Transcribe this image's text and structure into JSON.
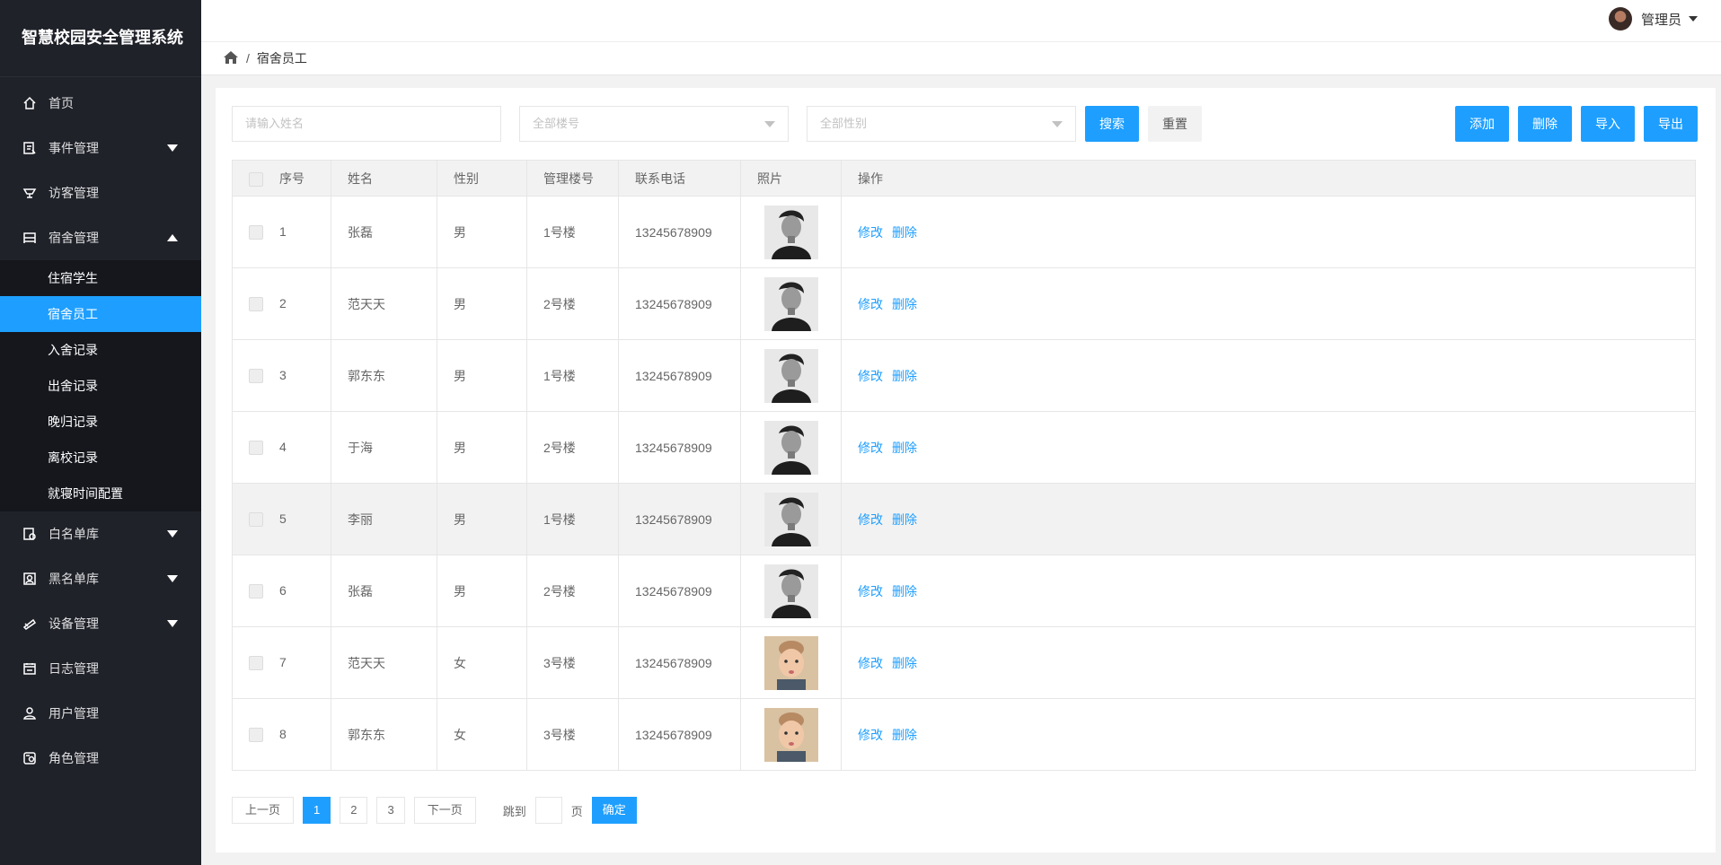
{
  "app": {
    "title": "智慧校园安全管理系统"
  },
  "sidebar": {
    "items": [
      {
        "label": "首页",
        "icon": "home-icon"
      },
      {
        "label": "事件管理",
        "icon": "event-icon"
      },
      {
        "label": "访客管理",
        "icon": "visitor-icon"
      },
      {
        "label": "宿舍管理",
        "icon": "dorm-icon"
      }
    ],
    "dorm_sub": [
      "住宿学生",
      "宿舍员工",
      "入舍记录",
      "出舍记录",
      "晚归记录",
      "离校记录",
      "就寝时间配置"
    ],
    "active_sub": "宿舍员工",
    "items2": [
      {
        "label": "白名单库",
        "icon": "whitelist-icon"
      },
      {
        "label": "黑名单库",
        "icon": "blacklist-icon"
      },
      {
        "label": "设备管理",
        "icon": "device-icon"
      },
      {
        "label": "日志管理",
        "icon": "log-icon"
      },
      {
        "label": "用户管理",
        "icon": "user-icon"
      },
      {
        "label": "角色管理",
        "icon": "role-icon"
      }
    ]
  },
  "header": {
    "user": "管理员"
  },
  "breadcrumb": {
    "current": "宿舍员工"
  },
  "filter": {
    "name_placeholder": "请输入姓名",
    "building_select": "全部楼号",
    "gender_select": "全部性别",
    "search": "搜索",
    "reset": "重置",
    "add": "添加",
    "delete": "删除",
    "import": "导入",
    "export": "导出"
  },
  "table": {
    "headers": [
      "序号",
      "姓名",
      "性别",
      "管理楼号",
      "联系电话",
      "照片",
      "操作"
    ],
    "rows": [
      {
        "no": "1",
        "name": "张磊",
        "gender": "男",
        "building": "1号楼",
        "phone": "13245678909"
      },
      {
        "no": "2",
        "name": "范天天",
        "gender": "男",
        "building": "2号楼",
        "phone": "13245678909"
      },
      {
        "no": "3",
        "name": "郭东东",
        "gender": "男",
        "building": "1号楼",
        "phone": "13245678909"
      },
      {
        "no": "4",
        "name": "于海",
        "gender": "男",
        "building": "2号楼",
        "phone": "13245678909"
      },
      {
        "no": "5",
        "name": "李丽",
        "gender": "男",
        "building": "1号楼",
        "phone": "13245678909"
      },
      {
        "no": "6",
        "name": "张磊",
        "gender": "男",
        "building": "2号楼",
        "phone": "13245678909"
      },
      {
        "no": "7",
        "name": "范天天",
        "gender": "女",
        "building": "3号楼",
        "phone": "13245678909"
      },
      {
        "no": "8",
        "name": "郭东东",
        "gender": "女",
        "building": "3号楼",
        "phone": "13245678909"
      }
    ],
    "edit": "修改",
    "remove": "删除"
  },
  "pager": {
    "prev": "上一页",
    "pages": [
      "1",
      "2",
      "3"
    ],
    "next": "下一页",
    "jump_to": "跳到",
    "page_unit": "页",
    "confirm": "确定"
  },
  "colors": {
    "accent": "#1e9fff",
    "sidebar_bg": "#20222a"
  }
}
